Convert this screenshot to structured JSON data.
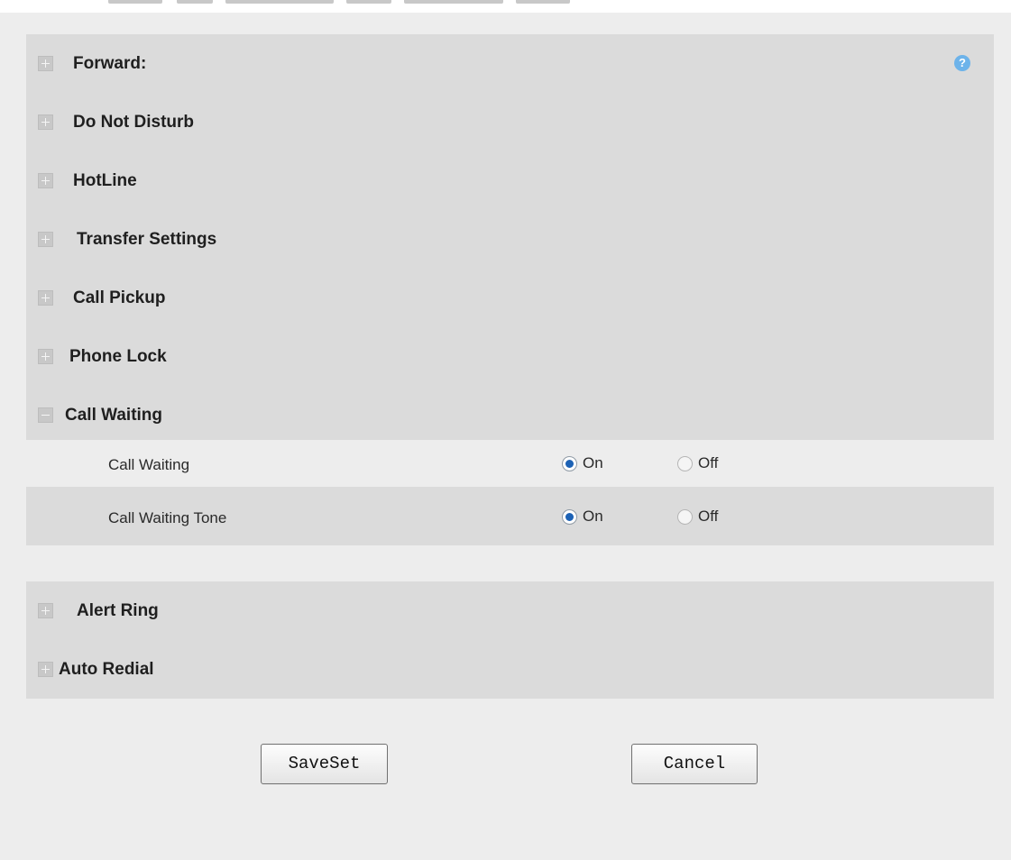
{
  "sections_top": [
    {
      "label": "Forward:",
      "state": "collapsed"
    },
    {
      "label": "Do Not Disturb",
      "state": "collapsed"
    },
    {
      "label": "HotLine",
      "state": "collapsed"
    },
    {
      "label": "Transfer Settings",
      "state": "collapsed"
    },
    {
      "label": "Call Pickup",
      "state": "collapsed"
    },
    {
      "label": "Phone Lock",
      "state": "collapsed"
    },
    {
      "label": "Call Waiting",
      "state": "expanded"
    }
  ],
  "help_icon": {
    "glyph": "?",
    "icon": "help-icon"
  },
  "call_waiting_options": [
    {
      "label": "Call Waiting",
      "on_label": "On",
      "off_label": "Off",
      "selected": "On"
    },
    {
      "label": "Call Waiting Tone",
      "on_label": "On",
      "off_label": "Off",
      "selected": "On"
    }
  ],
  "sections_bottom": [
    {
      "label": "Alert Ring",
      "state": "collapsed"
    },
    {
      "label": "Auto Redial",
      "state": "collapsed"
    }
  ],
  "buttons": {
    "save_label": "SaveSet",
    "cancel_label": "Cancel"
  },
  "colors": {
    "section_background": "#dbdbdb",
    "page_background": "#ededed",
    "radio_selected": "#1d62b5",
    "help_icon": "#6db3ea"
  }
}
